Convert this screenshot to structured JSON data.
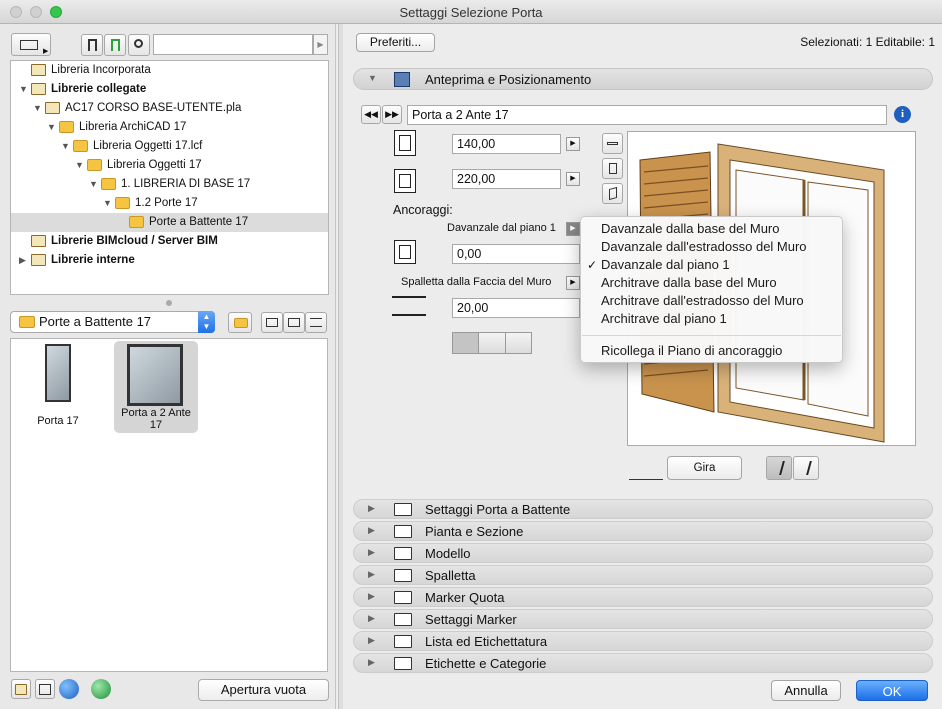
{
  "window": {
    "title": "Settaggi Selezione Porta"
  },
  "left": {
    "search": {
      "value": "",
      "placeholder": ""
    },
    "tree": [
      {
        "label": "Libreria Incorporata",
        "bold": false,
        "level": 0,
        "arrow": "",
        "icon": "library-icon"
      },
      {
        "label": "Librerie collegate",
        "bold": true,
        "level": 0,
        "arrow": "▼",
        "icon": "linked-libraries-icon"
      },
      {
        "label": "AC17 CORSO BASE-UTENTE.pla",
        "bold": false,
        "level": 1,
        "arrow": "▼",
        "icon": "archive-icon"
      },
      {
        "label": "Libreria ArchiCAD 17",
        "bold": false,
        "level": 2,
        "arrow": "▼",
        "icon": "folder-icon"
      },
      {
        "label": "Libreria Oggetti 17.lcf",
        "bold": false,
        "level": 3,
        "arrow": "▼",
        "icon": "folder-icon"
      },
      {
        "label": "Libreria Oggetti 17",
        "bold": false,
        "level": 4,
        "arrow": "▼",
        "icon": "folder-icon"
      },
      {
        "label": "1. LIBRERIA DI BASE 17",
        "bold": false,
        "level": 5,
        "arrow": "▼",
        "icon": "folder-icon"
      },
      {
        "label": "1.2 Porte 17",
        "bold": false,
        "level": 6,
        "arrow": "▼",
        "icon": "folder-icon"
      },
      {
        "label": "Porte a Battente 17",
        "bold": false,
        "level": 7,
        "arrow": "",
        "icon": "folder-icon",
        "selected": true
      },
      {
        "label": "Librerie BIMcloud / Server BIM",
        "bold": true,
        "level": 0,
        "arrow": "",
        "icon": "bimcloud-icon"
      },
      {
        "label": "Librerie interne",
        "bold": true,
        "level": 0,
        "arrow": "▶",
        "icon": "internal-libraries-icon"
      }
    ],
    "folder_combo": "Porte a Battente 17",
    "items": [
      {
        "label": "Porta 17"
      },
      {
        "label": "Porta a 2 Ante 17"
      }
    ],
    "open_empty_button": "Apertura vuota"
  },
  "right": {
    "favorites_button": "Preferiti...",
    "selection_status": "Selezionati: 1 Editabile: 1",
    "preview_section": "Anteprima e Posizionamento",
    "object_name": "Porta a 2 Ante 17",
    "width_value": "140,00",
    "height_value": "220,00",
    "anchors_label": "Ancoraggi:",
    "anchor_mode": "Davanzale dal piano 1",
    "anchor_value": "0,00",
    "reveal_mode": "Spalletta dalla Faccia del Muro",
    "reveal_value": "20,00",
    "flip_button": "Gira",
    "menu": {
      "items": [
        {
          "label": "Davanzale dalla base del Muro",
          "checked": false
        },
        {
          "label": "Davanzale dall'estradosso del Muro",
          "checked": false
        },
        {
          "label": "Davanzale dal piano 1",
          "checked": true
        },
        {
          "label": "Architrave dalla base del Muro",
          "checked": false
        },
        {
          "label": "Architrave dall'estradosso del Muro",
          "checked": false
        },
        {
          "label": "Architrave dal piano 1",
          "checked": false
        }
      ],
      "extra": "Ricollega il Piano di ancoraggio"
    },
    "sections": [
      "Settaggi Porta a Battente",
      "Pianta e Sezione",
      "Modello",
      "Spalletta",
      "Marker Quota",
      "Settaggi Marker",
      "Lista ed Etichettatura",
      "Etichette e Categorie"
    ],
    "cancel_button": "Annulla",
    "ok_button": "OK"
  }
}
